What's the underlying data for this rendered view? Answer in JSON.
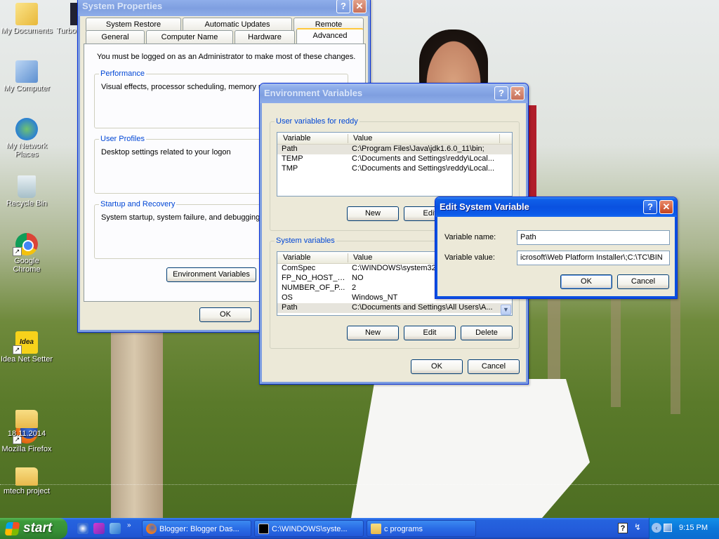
{
  "desktop": {
    "icons": [
      {
        "label": "My Documents"
      },
      {
        "label": "Turbo"
      },
      {
        "label": "My Computer"
      },
      {
        "label": "My Network Places"
      },
      {
        "label": "Recycle Bin"
      },
      {
        "label": "Google Chrome"
      },
      {
        "label": "Idea Net Setter"
      },
      {
        "label": "Mozilla Firefox"
      },
      {
        "label": "18.11.2014"
      },
      {
        "label": "mtech project"
      }
    ],
    "idea_logo": "Idea"
  },
  "system_properties": {
    "title": "System Properties",
    "tabs_row1": [
      "System Restore",
      "Automatic Updates",
      "Remote"
    ],
    "tabs_row2": [
      "General",
      "Computer Name",
      "Hardware",
      "Advanced"
    ],
    "active_tab": "Advanced",
    "admin_note": "You must be logged on as an Administrator to make most of these changes.",
    "performance": {
      "legend": "Performance",
      "text": "Visual effects, processor scheduling, memory us"
    },
    "user_profiles": {
      "legend": "User Profiles",
      "text": "Desktop settings related to your logon"
    },
    "startup_recovery": {
      "legend": "Startup and Recovery",
      "text": "System startup, system failure, and debugging in"
    },
    "env_button": "Environment Variables",
    "ok": "OK"
  },
  "environment_variables": {
    "title": "Environment Variables",
    "user_group": "User variables for reddy",
    "system_group": "System variables",
    "col_variable": "Variable",
    "col_value": "Value",
    "user_vars": [
      {
        "name": "Path",
        "value": "C:\\Program Files\\Java\\jdk1.6.0_11\\bin;"
      },
      {
        "name": "TEMP",
        "value": "C:\\Documents and Settings\\reddy\\Local..."
      },
      {
        "name": "TMP",
        "value": "C:\\Documents and Settings\\reddy\\Local..."
      }
    ],
    "system_vars": [
      {
        "name": "ComSpec",
        "value": "C:\\WINDOWS\\system32\\"
      },
      {
        "name": "FP_NO_HOST_C...",
        "value": "NO"
      },
      {
        "name": "NUMBER_OF_P...",
        "value": "2"
      },
      {
        "name": "OS",
        "value": "Windows_NT"
      },
      {
        "name": "Path",
        "value": "C:\\Documents and Settings\\All Users\\A..."
      }
    ],
    "new": "New",
    "edit": "Edit",
    "delete": "Delete",
    "ok": "OK",
    "cancel": "Cancel"
  },
  "edit_system_variable": {
    "title": "Edit System Variable",
    "name_label": "Variable name:",
    "name_value": "Path",
    "value_label": "Variable value:",
    "value_value": "icrosoft\\Web Platform Installer\\;C:\\TC\\BIN",
    "ok": "OK",
    "cancel": "Cancel"
  },
  "taskbar": {
    "start": "start",
    "tasks": [
      {
        "label": "Blogger: Blogger Das..."
      },
      {
        "label": "C:\\WINDOWS\\syste..."
      },
      {
        "label": "c programs"
      }
    ],
    "clock": "9:15 PM"
  },
  "titlebar_buttons": {
    "help": "?",
    "close": "✕"
  },
  "colors": {
    "xp_blue": "#0a51e0",
    "start_green": "#3c9a3a",
    "link_blue": "#0046d5"
  }
}
